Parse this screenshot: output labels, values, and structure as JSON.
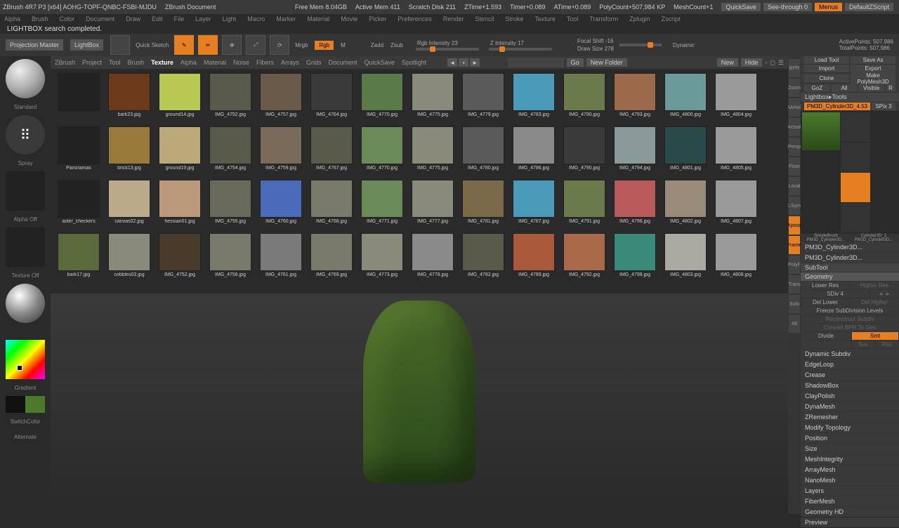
{
  "title": "ZBrush 4R7 P3 [x64] AOHG-TOPF-QNBC-FSBI-MJDU",
  "doc_label": "ZBrush Document",
  "stats": {
    "free_mem": "Free Mem 8.04GB",
    "active_mem": "Active Mem 411",
    "scratch": "Scratch Disk 211",
    "ztime": "ZTime+1.593",
    "timer": "Timer+0.089",
    "atimer": "ATime+0.089",
    "polycount": "PolyCount+507,984 KP",
    "meshcount": "MeshCount+1"
  },
  "top_buttons": {
    "quicksave": "QuickSave",
    "seethrough": "See-through  0",
    "menus": "Menus",
    "script": "DefaultZScript"
  },
  "menubar": [
    "Alpha",
    "Brush",
    "Color",
    "Document",
    "Draw",
    "Edit",
    "File",
    "Layer",
    "Light",
    "Macro",
    "Marker",
    "Material",
    "Movie",
    "Picker",
    "Preferences",
    "Render",
    "Stencil",
    "Stroke",
    "Texture",
    "Tool",
    "Transform",
    "Zplugin",
    "Zscript"
  ],
  "status": "LIGHTBOX search completed.",
  "toolrow": {
    "proj": "Projection Master",
    "lightbox": "LightBox",
    "quick": "Quick Sketch",
    "tools": [
      "Edit",
      "Draw",
      "Move",
      "Scale",
      "Rotate"
    ],
    "mrgb": "Mrgb",
    "rgb": "Rgb",
    "m": "M",
    "zadd": "Zadd",
    "zsub": "Zsub",
    "rgb_int": "Rgb Intensity 23",
    "z_int": "Z Intensity 17",
    "focal": "Focal Shift -16",
    "draw_size": "Draw Size 278",
    "dynamic": "Dynamic",
    "active_pts": "ActivePoints: 507,986",
    "total_pts": "TotalPoints: 507,986"
  },
  "left": {
    "brush_name": "Standard",
    "stroke_name": "Spray",
    "alpha": "Alpha Off",
    "texture": "Texture Off",
    "gradient": "Gradient",
    "switch": "SwitchColor",
    "alternate": "Alternate"
  },
  "lightbox": {
    "tabs": [
      "ZBrush",
      "Project",
      "Tool",
      "Brush",
      "Texture",
      "Alpha",
      "Material",
      "Noise",
      "Fibers",
      "Arrays",
      "Grids",
      "Document",
      "QuickSave",
      "Spotlight"
    ],
    "active_tab": "Texture",
    "go": "Go",
    "newfolder": "New Folder",
    "new": "New",
    "hide": "Hide",
    "items_row0": [
      {
        "name": "",
        "c": "#222"
      },
      {
        "name": "bark23.jpg",
        "c": "#6a3a1a"
      },
      {
        "name": "ground14.jpg",
        "c": "#b8c850"
      },
      {
        "name": "IMG_4752.jpg",
        "c": "#5a5a4a"
      },
      {
        "name": "IMG_4757.jpg",
        "c": "#6a5a4a"
      },
      {
        "name": "IMG_4764.jpg",
        "c": "#3a3a3a"
      },
      {
        "name": "IMG_4770.jpg",
        "c": "#5a7a4a"
      },
      {
        "name": "IMG_4775.jpg",
        "c": "#8a8a7a"
      },
      {
        "name": "IMG_4779.jpg",
        "c": "#5a5a5a"
      },
      {
        "name": "IMG_4783.jpg",
        "c": "#4a9aba"
      },
      {
        "name": "IMG_4790.jpg",
        "c": "#6a7a4a"
      },
      {
        "name": "IMG_4793.jpg",
        "c": "#9a6a4a"
      },
      {
        "name": "IMG_4800.jpg",
        "c": "#6a9a9a"
      },
      {
        "name": "IMG_4804.jpg",
        "c": "#9a9a9a"
      }
    ],
    "items_row1": [
      {
        "name": "Panoramas",
        "c": "#222"
      },
      {
        "name": "brick13.jpg",
        "c": "#9a7a3a"
      },
      {
        "name": "ground19.jpg",
        "c": "#baaa7a"
      },
      {
        "name": "IMG_4754.jpg",
        "c": "#5a5a4a"
      },
      {
        "name": "IMG_4759.jpg",
        "c": "#7a6a5a"
      },
      {
        "name": "IMG_4767.jpg",
        "c": "#5a5a4a"
      },
      {
        "name": "IMG_4770.jpg",
        "c": "#6a8a5a"
      },
      {
        "name": "IMG_4775.jpg",
        "c": "#8a8a7a"
      },
      {
        "name": "IMG_4780.jpg",
        "c": "#5a5a5a"
      },
      {
        "name": "IMG_4786.jpg",
        "c": "#8a8a8a"
      },
      {
        "name": "IMG_4790.jpg",
        "c": "#3a3a3a"
      },
      {
        "name": "IMG_4794.jpg",
        "c": "#8a9a9a"
      },
      {
        "name": "IMG_4801.jpg",
        "c": "#2a4a4a"
      },
      {
        "name": "IMG_4805.jpg",
        "c": "#9a9a9a"
      }
    ],
    "items_row2": [
      {
        "name": "aster_checkers",
        "c": "#222"
      },
      {
        "name": "canvas02.jpg",
        "c": "#baaa8a"
      },
      {
        "name": "hessian01.jpg",
        "c": "#ba9a7a"
      },
      {
        "name": "IMG_4755.jpg",
        "c": "#6a6a5a"
      },
      {
        "name": "IMG_4760.jpg",
        "c": "#4a6aba"
      },
      {
        "name": "IMG_4768.jpg",
        "c": "#7a7a6a"
      },
      {
        "name": "IMG_4771.jpg",
        "c": "#6a8a5a"
      },
      {
        "name": "IMG_4777.jpg",
        "c": "#8a8a7a"
      },
      {
        "name": "IMG_4781.jpg",
        "c": "#7a6a4a"
      },
      {
        "name": "IMG_4787.jpg",
        "c": "#4a9aba"
      },
      {
        "name": "IMG_4791.jpg",
        "c": "#6a7a4a"
      },
      {
        "name": "IMG_4796.jpg",
        "c": "#ba5a5a"
      },
      {
        "name": "IMG_4802.jpg",
        "c": "#9a8a7a"
      },
      {
        "name": "IMG_4807.jpg",
        "c": "#9a9a9a"
      }
    ],
    "items_row3": [
      {
        "name": "bark17.jpg",
        "c": "#5a6a3a"
      },
      {
        "name": "cobbles03.jpg",
        "c": "#8a8a7a"
      },
      {
        "name": "IMG_4752.jpg",
        "c": "#4a3a2a"
      },
      {
        "name": "IMG_4756.jpg",
        "c": "#7a7a6a"
      },
      {
        "name": "IMG_4761.jpg",
        "c": "#7a7a7a"
      },
      {
        "name": "IMG_4769.jpg",
        "c": "#7a7a6a"
      },
      {
        "name": "IMG_4773.jpg",
        "c": "#8a8a7a"
      },
      {
        "name": "IMG_4778.jpg",
        "c": "#8a8a8a"
      },
      {
        "name": "IMG_4782.jpg",
        "c": "#5a5a4a"
      },
      {
        "name": "IMG_4789.jpg",
        "c": "#aa5a3a"
      },
      {
        "name": "IMG_4792.jpg",
        "c": "#aa6a4a"
      },
      {
        "name": "IMG_4798.jpg",
        "c": "#3a8a7a"
      },
      {
        "name": "IMG_4803.jpg",
        "c": "#aaaaa0"
      },
      {
        "name": "IMG_4808.jpg",
        "c": "#9a9a9a"
      }
    ]
  },
  "side_icons": [
    "BPR",
    "Zoom",
    "AAHalf",
    "Actual",
    "Persp",
    "Floor",
    "Local",
    "LSym",
    "Xpose",
    "Frame",
    "PolyF",
    "Trans",
    "Solo",
    "All"
  ],
  "right": {
    "row1": [
      "Load Tool",
      "Save As"
    ],
    "row2": [
      "Import",
      "Export"
    ],
    "row3": [
      "Clone",
      "Make PolyMesh3D"
    ],
    "row4": [
      "GoZ",
      "All",
      "Visible",
      "R"
    ],
    "header": "Lightbox▸Tools",
    "tool_name": "PM3D_Cylinder3D_4.53",
    "spix": "SPix 3",
    "thumbs": [
      "SimpleBrush",
      "Cylinder3D_1",
      "PM3D_Cylinder3D...",
      "PM3D_Cylinder3D..."
    ],
    "tree": [
      "PM3D_Cylinder3D...",
      "PM3D_Cylinder3D..."
    ],
    "subtool": "SubTool",
    "geometry": "Geometry",
    "lower": "Lower Res",
    "higher": "Higher Res",
    "sdiv": "SDiv 4",
    "del_lower": "Del Lower",
    "del_higher": "Del Higher",
    "freeze": "Freeze SubDivision Levels",
    "recon": "Reconstruct Subdiv",
    "convert": "Convert BPR To Geo",
    "smt": "Smt",
    "suv": "Suv",
    "rstr": "Rstr",
    "divide": "Divide",
    "sections": [
      "Dynamic Subdiv",
      "EdgeLoop",
      "Crease",
      "ShadowBox",
      "ClayPolish",
      "DynaMesh",
      "ZRemesher",
      "Modify Topology",
      "Position",
      "Size",
      "MeshIntegrity"
    ],
    "sections2": [
      "ArrayMesh",
      "NanoMesh",
      "Layers",
      "FiberMesh",
      "Geometry HD",
      "Preview"
    ]
  }
}
